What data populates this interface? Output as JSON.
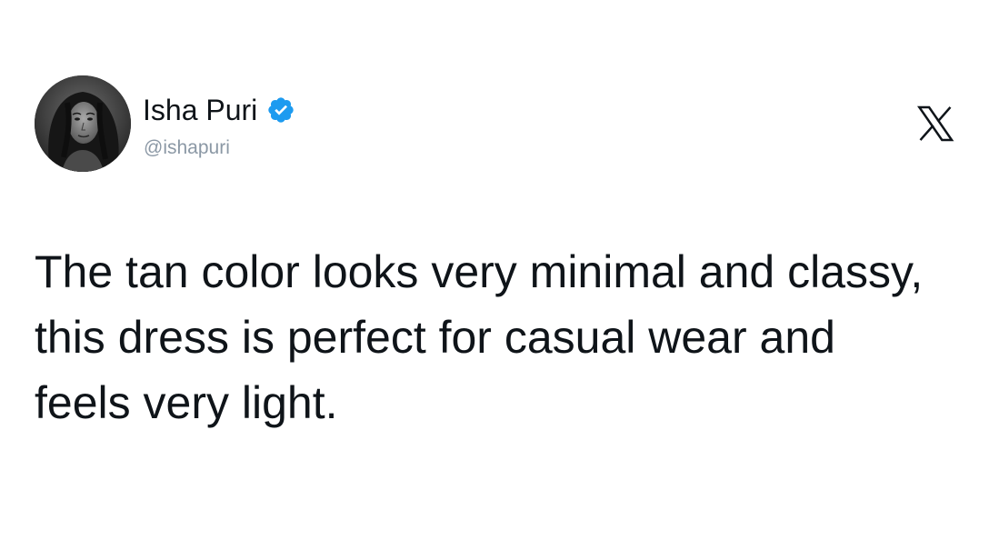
{
  "author": {
    "display_name": "Isha Puri",
    "handle": "@ishapuri",
    "verified": true,
    "avatar_icon": "profile-photo"
  },
  "tweet": {
    "text": "The tan color looks very minimal and classy, this dress is perfect for casual wear and feels very light."
  },
  "colors": {
    "text": "#0f1419",
    "handle": "#8b98a5",
    "verified_badge": "#1d9bf0",
    "background": "#ffffff"
  },
  "icons": {
    "verified": "verified-badge-icon",
    "brand": "x-logo-icon"
  }
}
